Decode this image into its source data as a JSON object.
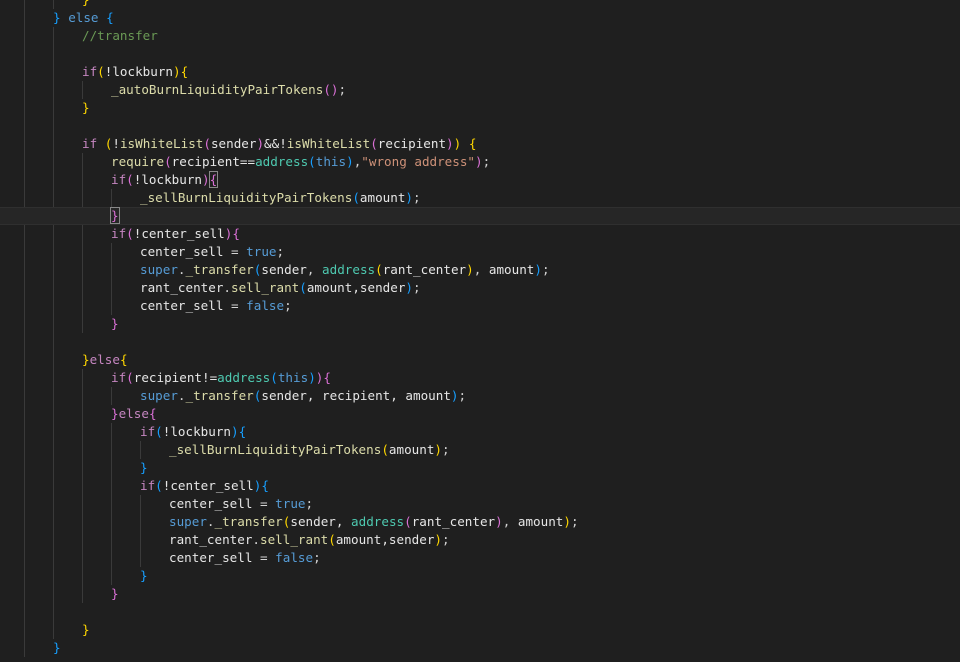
{
  "editor": {
    "language": "solidity",
    "colors": {
      "background": "#1f1f1f",
      "keyword": "#569cd6",
      "control": "#c586c0",
      "function": "#dcdcaa",
      "variable": "#e6e6e6",
      "type": "#4ec9b0",
      "string": "#ce9178",
      "comment": "#6a9955",
      "bracket_level_1": "#ffd700",
      "bracket_level_2": "#da70d6",
      "bracket_level_3": "#179fff"
    },
    "lines": [
      {
        "indent": 2,
        "tokens": [
          [
            "}",
            "b1"
          ]
        ]
      },
      {
        "indent": 1,
        "tokens": [
          [
            "}",
            "b3"
          ],
          [
            " ",
            "p"
          ],
          [
            "else",
            "kw"
          ],
          [
            " ",
            "p"
          ],
          [
            "{",
            "b3"
          ]
        ]
      },
      {
        "indent": 2,
        "tokens": [
          [
            "//transfer",
            "cm"
          ]
        ]
      },
      {
        "indent": 0,
        "tokens": []
      },
      {
        "indent": 2,
        "tokens": [
          [
            "if",
            "ctrl"
          ],
          [
            "(",
            "b1"
          ],
          [
            "!lockburn",
            "var"
          ],
          [
            ")",
            "b1"
          ],
          [
            "{",
            "b1"
          ]
        ]
      },
      {
        "indent": 3,
        "tokens": [
          [
            "_autoBurnLiquidityPairTokens",
            "fn"
          ],
          [
            "()",
            "b2"
          ],
          [
            ";",
            "p"
          ]
        ]
      },
      {
        "indent": 2,
        "tokens": [
          [
            "}",
            "b1"
          ]
        ]
      },
      {
        "indent": 0,
        "tokens": []
      },
      {
        "indent": 2,
        "tokens": [
          [
            "if",
            "ctrl"
          ],
          [
            " ",
            "p"
          ],
          [
            "(",
            "b1"
          ],
          [
            "!",
            "var"
          ],
          [
            "isWhiteList",
            "fn"
          ],
          [
            "(",
            "b2"
          ],
          [
            "sender",
            "var"
          ],
          [
            ")",
            "b2"
          ],
          [
            "&&!",
            "var"
          ],
          [
            "isWhiteList",
            "fn"
          ],
          [
            "(",
            "b2"
          ],
          [
            "recipient",
            "var"
          ],
          [
            ")",
            "b2"
          ],
          [
            ")",
            "b1"
          ],
          [
            " ",
            "p"
          ],
          [
            "{",
            "b1"
          ]
        ]
      },
      {
        "indent": 3,
        "tokens": [
          [
            "require",
            "fn"
          ],
          [
            "(",
            "b2"
          ],
          [
            "recipient==",
            "var"
          ],
          [
            "address",
            "type"
          ],
          [
            "(",
            "b3"
          ],
          [
            "this",
            "kw"
          ],
          [
            ")",
            "b3"
          ],
          [
            ",",
            "p"
          ],
          [
            "\"wrong address\"",
            "str"
          ],
          [
            ")",
            "b2"
          ],
          [
            ";",
            "p"
          ]
        ]
      },
      {
        "indent": 3,
        "tokens": [
          [
            "if",
            "ctrl"
          ],
          [
            "(",
            "b2"
          ],
          [
            "!lockburn",
            "var"
          ],
          [
            ")",
            "b2"
          ],
          [
            "{",
            "b2"
          ]
        ],
        "cursor": true
      },
      {
        "indent": 4,
        "tokens": [
          [
            "_sellBurnLiquidityPairTokens",
            "fn"
          ],
          [
            "(",
            "b3"
          ],
          [
            "amount",
            "var"
          ],
          [
            ")",
            "b3"
          ],
          [
            ";",
            "p"
          ]
        ]
      },
      {
        "indent": 3,
        "tokens": [
          [
            "}",
            "b2"
          ]
        ],
        "active": true,
        "cursor": true
      },
      {
        "indent": 3,
        "tokens": [
          [
            "if",
            "ctrl"
          ],
          [
            "(",
            "b2"
          ],
          [
            "!center_sell",
            "var"
          ],
          [
            ")",
            "b2"
          ],
          [
            "{",
            "b2"
          ]
        ]
      },
      {
        "indent": 4,
        "tokens": [
          [
            "center_sell",
            "var"
          ],
          [
            " = ",
            "p"
          ],
          [
            "true",
            "kw"
          ],
          [
            ";",
            "p"
          ]
        ]
      },
      {
        "indent": 4,
        "tokens": [
          [
            "super",
            "kw"
          ],
          [
            ".",
            "p"
          ],
          [
            "_transfer",
            "fn"
          ],
          [
            "(",
            "b3"
          ],
          [
            "sender",
            "var"
          ],
          [
            ", ",
            "p"
          ],
          [
            "address",
            "type"
          ],
          [
            "(",
            "b1"
          ],
          [
            "rant_center",
            "var"
          ],
          [
            ")",
            "b1"
          ],
          [
            ", ",
            "p"
          ],
          [
            "amount",
            "var"
          ],
          [
            ")",
            "b3"
          ],
          [
            ";",
            "p"
          ]
        ]
      },
      {
        "indent": 4,
        "tokens": [
          [
            "rant_center",
            "var"
          ],
          [
            ".",
            "p"
          ],
          [
            "sell_rant",
            "fn"
          ],
          [
            "(",
            "b3"
          ],
          [
            "amount,sender",
            "var"
          ],
          [
            ")",
            "b3"
          ],
          [
            ";",
            "p"
          ]
        ]
      },
      {
        "indent": 4,
        "tokens": [
          [
            "center_sell",
            "var"
          ],
          [
            " = ",
            "p"
          ],
          [
            "false",
            "kw"
          ],
          [
            ";",
            "p"
          ]
        ]
      },
      {
        "indent": 3,
        "tokens": [
          [
            "}",
            "b2"
          ]
        ]
      },
      {
        "indent": 0,
        "tokens": []
      },
      {
        "indent": 2,
        "tokens": [
          [
            "}",
            "b1"
          ],
          [
            "else",
            "ctrl"
          ],
          [
            "{",
            "b1"
          ]
        ]
      },
      {
        "indent": 3,
        "tokens": [
          [
            "if",
            "ctrl"
          ],
          [
            "(",
            "b2"
          ],
          [
            "recipient!=",
            "var"
          ],
          [
            "address",
            "type"
          ],
          [
            "(",
            "b3"
          ],
          [
            "this",
            "kw"
          ],
          [
            ")",
            "b3"
          ],
          [
            ")",
            "b2"
          ],
          [
            "{",
            "b2"
          ]
        ]
      },
      {
        "indent": 4,
        "tokens": [
          [
            "super",
            "kw"
          ],
          [
            ".",
            "p"
          ],
          [
            "_transfer",
            "fn"
          ],
          [
            "(",
            "b3"
          ],
          [
            "sender, recipient, amount",
            "var"
          ],
          [
            ")",
            "b3"
          ],
          [
            ";",
            "p"
          ]
        ]
      },
      {
        "indent": 3,
        "tokens": [
          [
            "}",
            "b2"
          ],
          [
            "else",
            "ctrl"
          ],
          [
            "{",
            "b2"
          ]
        ]
      },
      {
        "indent": 4,
        "tokens": [
          [
            "if",
            "ctrl"
          ],
          [
            "(",
            "b3"
          ],
          [
            "!lockburn",
            "var"
          ],
          [
            ")",
            "b3"
          ],
          [
            "{",
            "b3"
          ]
        ]
      },
      {
        "indent": 5,
        "tokens": [
          [
            "_sellBurnLiquidityPairTokens",
            "fn"
          ],
          [
            "(",
            "b1"
          ],
          [
            "amount",
            "var"
          ],
          [
            ")",
            "b1"
          ],
          [
            ";",
            "p"
          ]
        ]
      },
      {
        "indent": 4,
        "tokens": [
          [
            "}",
            "b3"
          ]
        ]
      },
      {
        "indent": 4,
        "tokens": [
          [
            "if",
            "ctrl"
          ],
          [
            "(",
            "b3"
          ],
          [
            "!center_sell",
            "var"
          ],
          [
            ")",
            "b3"
          ],
          [
            "{",
            "b3"
          ]
        ]
      },
      {
        "indent": 5,
        "tokens": [
          [
            "center_sell",
            "var"
          ],
          [
            " = ",
            "p"
          ],
          [
            "true",
            "kw"
          ],
          [
            ";",
            "p"
          ]
        ]
      },
      {
        "indent": 5,
        "tokens": [
          [
            "super",
            "kw"
          ],
          [
            ".",
            "p"
          ],
          [
            "_transfer",
            "fn"
          ],
          [
            "(",
            "b1"
          ],
          [
            "sender, ",
            "var"
          ],
          [
            "address",
            "type"
          ],
          [
            "(",
            "b2"
          ],
          [
            "rant_center",
            "var"
          ],
          [
            ")",
            "b2"
          ],
          [
            ", ",
            "p"
          ],
          [
            "amount",
            "var"
          ],
          [
            ")",
            "b1"
          ],
          [
            ";",
            "p"
          ]
        ]
      },
      {
        "indent": 5,
        "tokens": [
          [
            "rant_center",
            "var"
          ],
          [
            ".",
            "p"
          ],
          [
            "sell_rant",
            "fn"
          ],
          [
            "(",
            "b1"
          ],
          [
            "amount,sender",
            "var"
          ],
          [
            ")",
            "b1"
          ],
          [
            ";",
            "p"
          ]
        ]
      },
      {
        "indent": 5,
        "tokens": [
          [
            "center_sell",
            "var"
          ],
          [
            " = ",
            "p"
          ],
          [
            "false",
            "kw"
          ],
          [
            ";",
            "p"
          ]
        ]
      },
      {
        "indent": 4,
        "tokens": [
          [
            "}",
            "b3"
          ]
        ]
      },
      {
        "indent": 3,
        "tokens": [
          [
            "}",
            "b2"
          ]
        ]
      },
      {
        "indent": 0,
        "tokens": []
      },
      {
        "indent": 2,
        "tokens": [
          [
            "}",
            "b1"
          ]
        ]
      },
      {
        "indent": 1,
        "tokens": [
          [
            "}",
            "b3"
          ]
        ]
      }
    ]
  }
}
